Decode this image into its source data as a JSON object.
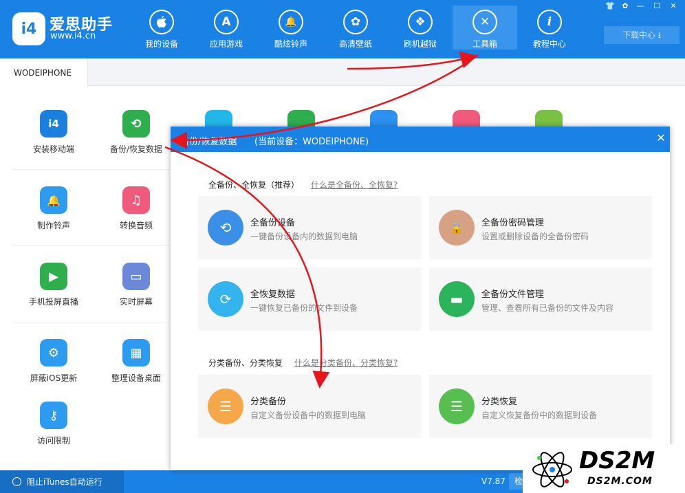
{
  "app": {
    "name": "爱思助手",
    "url": "www.i4.cn",
    "logo_text": "i4"
  },
  "nav": {
    "items": [
      {
        "label": "我的设备",
        "icon": "apple-icon",
        "glyph": ""
      },
      {
        "label": "应用游戏",
        "icon": "app-store-icon",
        "glyph": "A"
      },
      {
        "label": "酷炫铃声",
        "icon": "bell-icon",
        "glyph": "🔔"
      },
      {
        "label": "高清壁纸",
        "icon": "flower-icon",
        "glyph": "✿"
      },
      {
        "label": "刷机越狱",
        "icon": "dropbox-icon",
        "glyph": "❖"
      },
      {
        "label": "工具箱",
        "icon": "tools-icon",
        "glyph": "✕"
      },
      {
        "label": "教程中心",
        "icon": "info-icon",
        "glyph": "i"
      }
    ],
    "active_index": 5
  },
  "window_controls": {
    "shirt": "👕",
    "settings": "✿",
    "minimize": "—",
    "maximize": "☐",
    "close": "✕"
  },
  "download_center": "下载中心 ⭳",
  "device_tab": "WODEIPHONE",
  "tools": [
    {
      "label": "安装移动端",
      "icon": "i4-app-icon",
      "glyph": "i4",
      "color": "#1b7fe0"
    },
    {
      "label": "备份/恢复数据",
      "icon": "backup-restore-icon",
      "glyph": "⟲",
      "color": "#2fae4e"
    },
    {
      "label": "制作铃声",
      "icon": "bell-plus-icon",
      "glyph": "🔔",
      "color": "#2d9cf0"
    },
    {
      "label": "转换音频",
      "icon": "music-note-icon",
      "glyph": "♫",
      "color": "#f05b7b"
    },
    {
      "label": "手机投屏直播",
      "icon": "screen-cast-icon",
      "glyph": "▶",
      "color": "#2fae4e"
    },
    {
      "label": "实时屏幕",
      "icon": "monitor-icon",
      "glyph": "▭",
      "color": "#6c88d8"
    },
    {
      "label": "屏蔽iOS更新",
      "icon": "block-update-icon",
      "glyph": "⚙",
      "color": "#2d9cf0"
    },
    {
      "label": "整理设备桌面",
      "icon": "grid-icon",
      "glyph": "▦",
      "color": "#2d9cf0"
    },
    {
      "label": "访问限制",
      "icon": "key-icon",
      "glyph": "⚷",
      "color": "#2d9cf0"
    }
  ],
  "partial_tools": [
    {
      "icon": "transfer-icon",
      "color": "#22b7e8"
    },
    {
      "icon": "apple-id-icon",
      "color": "#2fae4e"
    },
    {
      "icon": "app-store-small-icon",
      "color": "#2d8ff0"
    },
    {
      "icon": "itunes-icon",
      "color": "#f05b7b"
    },
    {
      "icon": "box-icon",
      "color": "#7ac143"
    }
  ],
  "dialog": {
    "title": "备份/恢复数据",
    "device": "(当前设备：WODEIPHONE)",
    "close": "✕",
    "sections": [
      {
        "title": "全备份、全恢复（推荐）",
        "link": "什么是全备份、全恢复?",
        "cards": [
          {
            "title": "全备份设备",
            "desc": "一键备份设备内的数据到电脑",
            "icon": "full-backup-icon",
            "glyph": "⟲",
            "color": "#3a8fe6"
          },
          {
            "title": "全备份密码管理",
            "desc": "设置或删除设备的全备份密码",
            "icon": "lock-icon",
            "glyph": "🔒",
            "color": "#d6a184"
          },
          {
            "title": "全恢复数据",
            "desc": "一键恢复已备份的文件到设备",
            "icon": "full-restore-icon",
            "glyph": "⟳",
            "color": "#33b4ef"
          },
          {
            "title": "全备份文件管理",
            "desc": "管理、查看所有已备份的文件及内容",
            "icon": "folder-icon",
            "glyph": "▬",
            "color": "#2bb45c"
          }
        ]
      },
      {
        "title": "分类备份、分类恢复",
        "link": "什么是分类备份、分类恢复?",
        "cards": [
          {
            "title": "分类备份",
            "desc": "自定义备份设备中的数据到电脑",
            "icon": "category-backup-icon",
            "glyph": "☰",
            "color": "#f5a84a"
          },
          {
            "title": "分类恢复",
            "desc": "自定义恢复备份中的数据到设备",
            "icon": "category-restore-icon",
            "glyph": "☰",
            "color": "#56bf4f"
          }
        ]
      }
    ]
  },
  "statusbar": {
    "itunes_toggle": "阻止iTunes自动运行",
    "version": "V7.87",
    "check_update": "检查"
  },
  "watermark": {
    "main": "DS2M",
    "sub": "DS2M.COM"
  },
  "colors": {
    "primary": "#1b82e5",
    "annotation_arrow": "#e8141c"
  }
}
